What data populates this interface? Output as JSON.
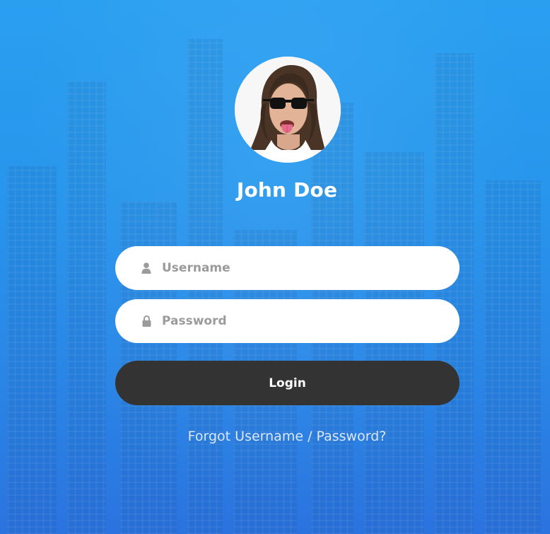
{
  "profile": {
    "name": "John Doe",
    "avatar_icon": "user-avatar-photo"
  },
  "form": {
    "username": {
      "placeholder": "Username",
      "value": "",
      "icon": "user-icon"
    },
    "password": {
      "placeholder": "Password",
      "value": "",
      "icon": "lock-icon"
    },
    "login_label": "Login",
    "forgot_label": "Forgot Username / Password?"
  },
  "colors": {
    "background_top": "#2a9ff0",
    "background_bottom": "#2b73df",
    "button": "#333333",
    "field": "#ffffff",
    "icon": "#9b9b9b"
  }
}
